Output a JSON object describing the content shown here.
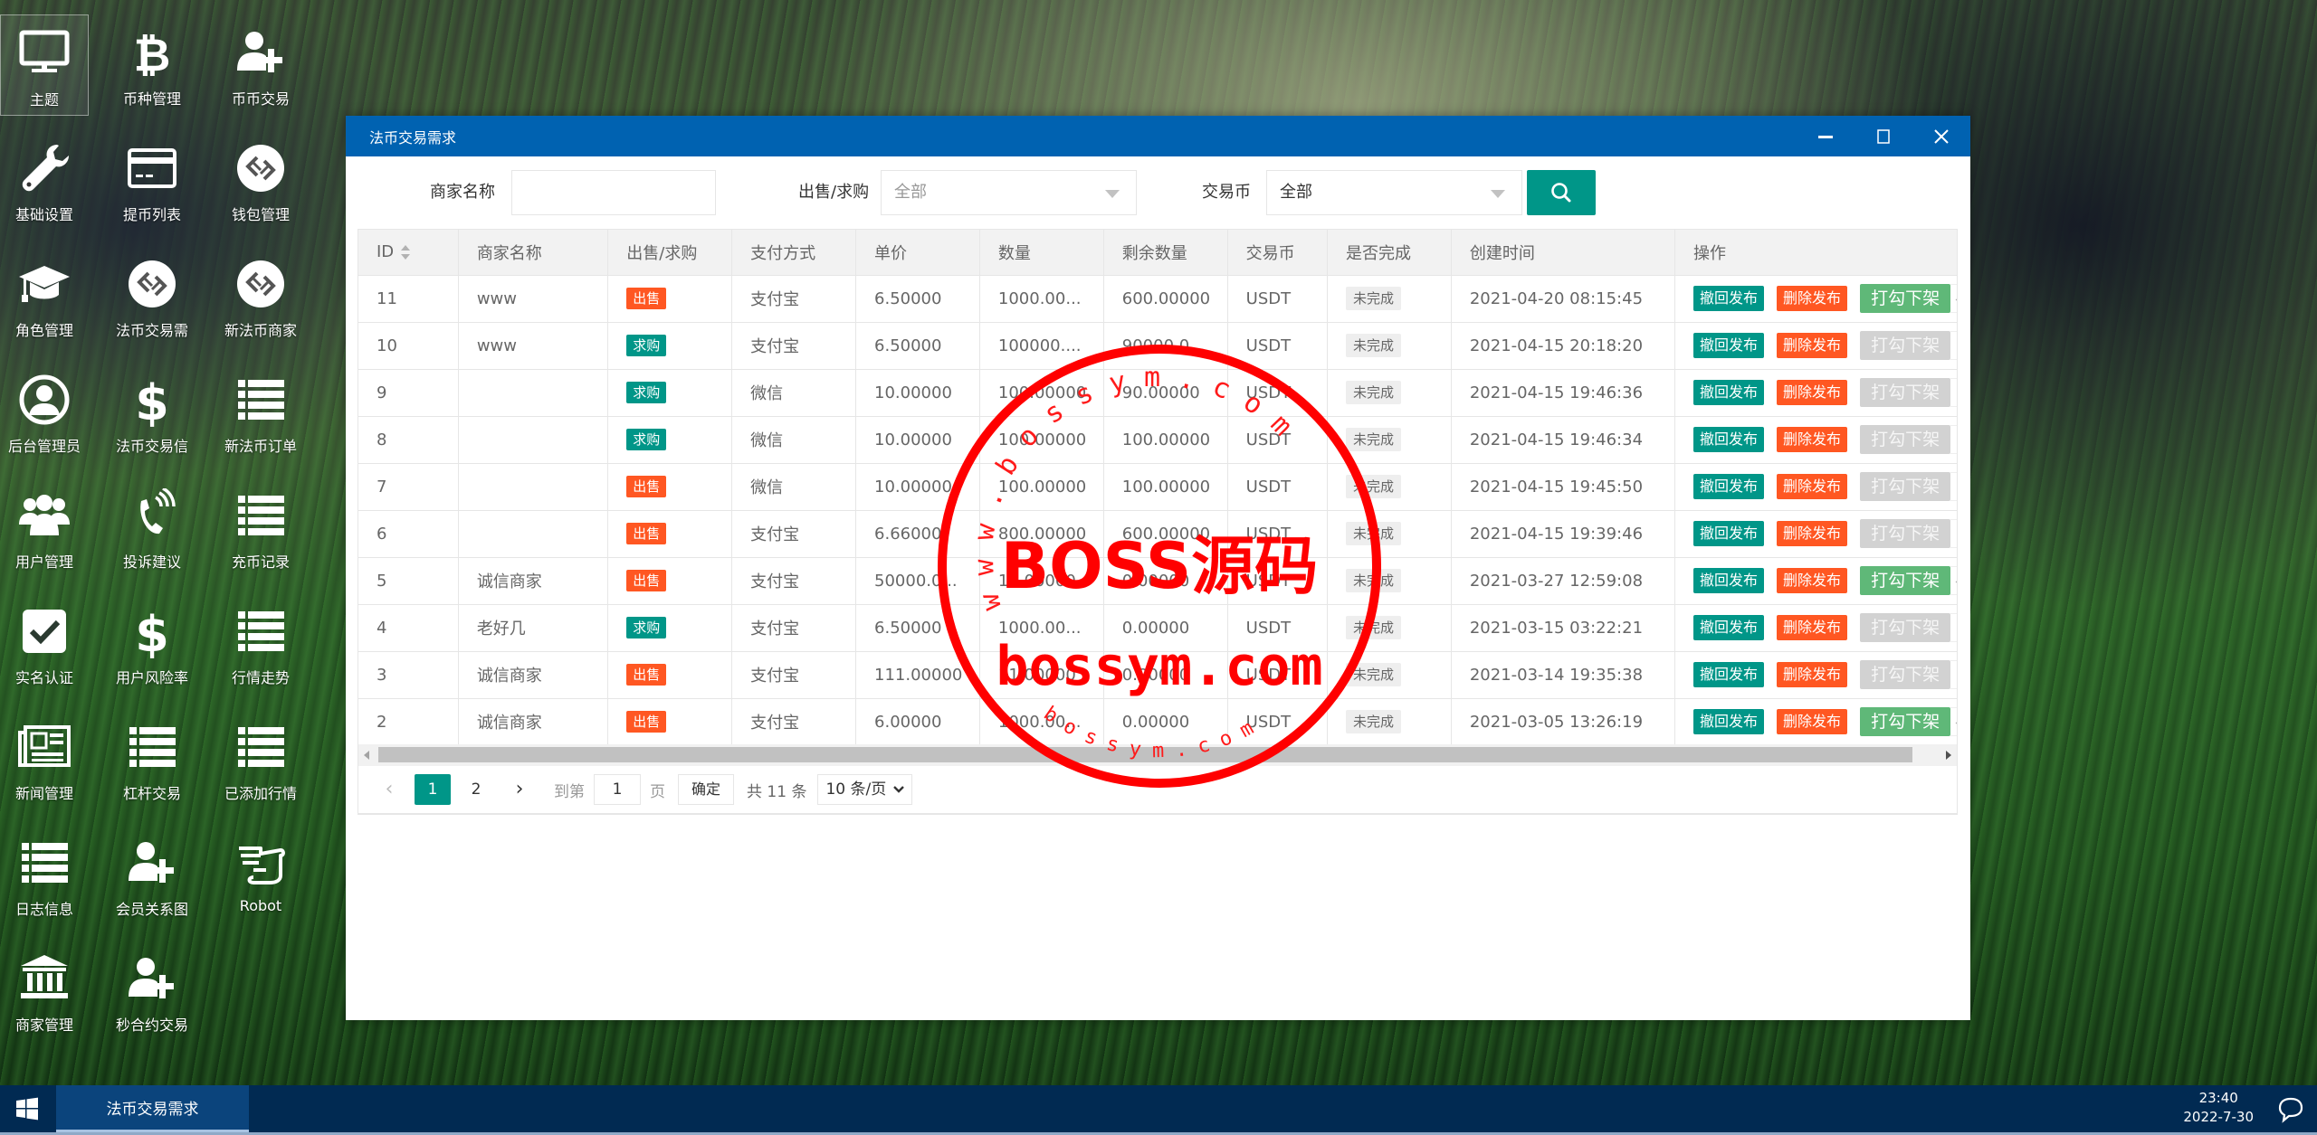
{
  "desktop": {
    "icons": [
      {
        "label": "主题",
        "icon": "monitor-icon",
        "selected": true
      },
      {
        "label": "币种管理",
        "icon": "bitcoin-icon"
      },
      {
        "label": "币币交易",
        "icon": "user-plus-icon"
      },
      {
        "label": "基础设置",
        "icon": "wrench-icon"
      },
      {
        "label": "提币列表",
        "icon": "credit-card-icon"
      },
      {
        "label": "钱包管理",
        "icon": "exchange-circle-icon"
      },
      {
        "label": "角色管理",
        "icon": "graduation-cap-icon"
      },
      {
        "label": "法币交易需",
        "icon": "exchange-circle-icon"
      },
      {
        "label": "新法币商家",
        "icon": "exchange-circle-icon"
      },
      {
        "label": "后台管理员",
        "icon": "user-circle-icon"
      },
      {
        "label": "法币交易信",
        "icon": "dollar-icon"
      },
      {
        "label": "新法币订单",
        "icon": "list-icon"
      },
      {
        "label": "用户管理",
        "icon": "users-icon"
      },
      {
        "label": "投诉建议",
        "icon": "phone-volume-icon"
      },
      {
        "label": "充币记录",
        "icon": "list-icon"
      },
      {
        "label": "实名认证",
        "icon": "checkbox-icon"
      },
      {
        "label": "用户风险率",
        "icon": "dollar-icon"
      },
      {
        "label": "行情走势",
        "icon": "list-icon"
      },
      {
        "label": "新闻管理",
        "icon": "newspaper-icon"
      },
      {
        "label": "杠杆交易",
        "icon": "list-icon"
      },
      {
        "label": "已添加行情",
        "icon": "list-icon"
      },
      {
        "label": "日志信息",
        "icon": "list-icon"
      },
      {
        "label": "会员关系图",
        "icon": "user-plus-icon"
      },
      {
        "label": "Robot",
        "icon": "hand-peace-icon"
      },
      {
        "label": "商家管理",
        "icon": "bank-icon"
      },
      {
        "label": "秒合约交易",
        "icon": "user-plus-icon"
      }
    ]
  },
  "window": {
    "title": "法币交易需求",
    "controls": {
      "minimize": "—",
      "maximize": "▢",
      "close": "X"
    }
  },
  "search": {
    "merchant_label": "商家名称",
    "merchant_value": "",
    "type_label": "出售/求购",
    "type_value": "全部",
    "coin_label": "交易币",
    "coin_value": "全部"
  },
  "table": {
    "columns": [
      "ID",
      "商家名称",
      "出售/求购",
      "支付方式",
      "单价",
      "数量",
      "剩余数量",
      "交易币",
      "是否完成",
      "创建时间",
      "操作"
    ],
    "rows": [
      {
        "id": "11",
        "merchant": "www",
        "type": "出售",
        "type_kind": "sell",
        "pay": "支付宝",
        "price": "6.50000",
        "qty": "1000.00...",
        "remain": "600.00000",
        "coin": "USDT",
        "done": "未完成",
        "created": "2021-04-20 08:15:45",
        "delist_enabled": true
      },
      {
        "id": "10",
        "merchant": "www",
        "type": "求购",
        "type_kind": "buy",
        "pay": "支付宝",
        "price": "6.50000",
        "qty": "100000....",
        "remain": "90000.0...",
        "coin": "USDT",
        "done": "未完成",
        "created": "2021-04-15 20:18:20",
        "delist_enabled": false
      },
      {
        "id": "9",
        "merchant": "",
        "type": "求购",
        "type_kind": "buy",
        "pay": "微信",
        "price": "10.00000",
        "qty": "100.00000",
        "remain": "90.00000",
        "coin": "USDT",
        "done": "未完成",
        "created": "2021-04-15 19:46:36",
        "delist_enabled": false
      },
      {
        "id": "8",
        "merchant": "",
        "type": "求购",
        "type_kind": "buy",
        "pay": "微信",
        "price": "10.00000",
        "qty": "100.00000",
        "remain": "100.00000",
        "coin": "USDT",
        "done": "未完成",
        "created": "2021-04-15 19:46:34",
        "delist_enabled": false
      },
      {
        "id": "7",
        "merchant": "",
        "type": "出售",
        "type_kind": "sell",
        "pay": "微信",
        "price": "10.00000",
        "qty": "100.00000",
        "remain": "100.00000",
        "coin": "USDT",
        "done": "未完成",
        "created": "2021-04-15 19:45:50",
        "delist_enabled": false
      },
      {
        "id": "6",
        "merchant": "",
        "type": "出售",
        "type_kind": "sell",
        "pay": "支付宝",
        "price": "6.66000",
        "qty": "800.00000",
        "remain": "600.00000",
        "coin": "USDT",
        "done": "未完成",
        "created": "2021-04-15 19:39:46",
        "delist_enabled": false
      },
      {
        "id": "5",
        "merchant": "诚信商家",
        "type": "出售",
        "type_kind": "sell",
        "pay": "支付宝",
        "price": "50000.0...",
        "qty": "18.00000",
        "remain": "0.00000",
        "coin": "USDT",
        "done": "未完成",
        "created": "2021-03-27 12:59:08",
        "delist_enabled": true
      },
      {
        "id": "4",
        "merchant": "老好几",
        "type": "求购",
        "type_kind": "buy",
        "pay": "支付宝",
        "price": "6.50000",
        "qty": "1000.00...",
        "remain": "0.00000",
        "coin": "USDT",
        "done": "未完成",
        "created": "2021-03-15 03:22:21",
        "delist_enabled": false
      },
      {
        "id": "3",
        "merchant": "诚信商家",
        "type": "出售",
        "type_kind": "sell",
        "pay": "支付宝",
        "price": "111.00000",
        "qty": "11.00000",
        "remain": "0.00000",
        "coin": "USDT",
        "done": "未完成",
        "created": "2021-03-14 19:35:38",
        "delist_enabled": false
      },
      {
        "id": "2",
        "merchant": "诚信商家",
        "type": "出售",
        "type_kind": "sell",
        "pay": "支付宝",
        "price": "6.00000",
        "qty": "1000.00...",
        "remain": "0.00000",
        "coin": "USDT",
        "done": "未完成",
        "created": "2021-03-05 13:26:19",
        "delist_enabled": true
      }
    ],
    "actions": {
      "withdraw": "撤回发布",
      "delete": "删除发布",
      "delist": "打勾下架"
    }
  },
  "pagination": {
    "pages": [
      "1",
      "2"
    ],
    "current": "1",
    "goto_label": "到第",
    "goto_value": "1",
    "page_unit": "页",
    "confirm": "确定",
    "total": "共 11 条",
    "limit": "10 条/页"
  },
  "watermark": {
    "main": "BOSS源码",
    "site": "bossym.com",
    "ring_top": "www.bossym.com",
    "ring_bottom": "bossym.com"
  },
  "taskbar": {
    "task": "法币交易需求",
    "time": "23:40",
    "date": "2022-7-30"
  },
  "colors": {
    "titlebar": "#0062b1",
    "primary": "#009688",
    "danger": "#ff5722",
    "success": "#5fb878",
    "taskbar": "#012a52",
    "stamp": "#ff0000"
  }
}
